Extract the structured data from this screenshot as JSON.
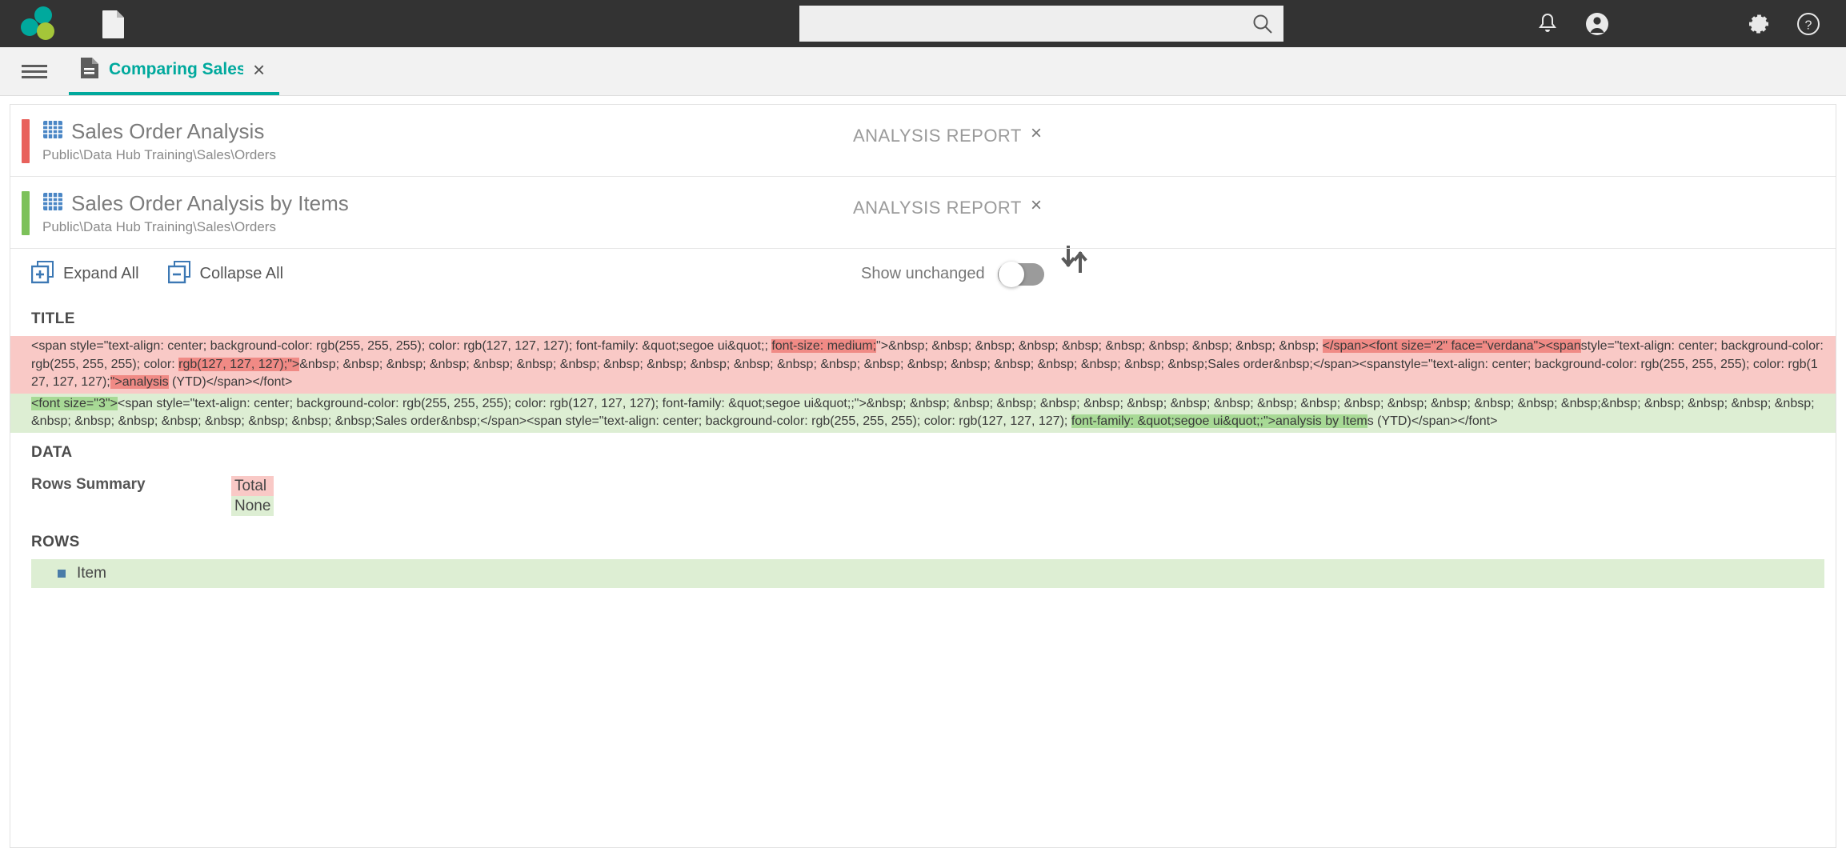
{
  "topbar": {
    "logo_name": "app-logo",
    "doc_icon": "document-icon",
    "search": {
      "value": "",
      "placeholder": ""
    },
    "icons": {
      "notifications": "bell-icon",
      "account": "user-account-icon",
      "settings": "gear-icon",
      "help": "help-icon"
    }
  },
  "tab": {
    "label": "Comparing Sales Orde",
    "close": "×",
    "icon": "document-compare-icon"
  },
  "reports": [
    {
      "title": "Sales Order Analysis",
      "path": "Public\\Data Hub Training\\Sales\\Orders",
      "kind": "ANALYSIS REPORT",
      "close": "×",
      "accent_color": "#e8615c",
      "icon": "grid-table-icon"
    },
    {
      "title": "Sales Order Analysis by Items",
      "path": "Public\\Data Hub Training\\Sales\\Orders",
      "kind": "ANALYSIS REPORT",
      "close": "×",
      "accent_color": "#7cc15a",
      "icon": "grid-table-icon"
    }
  ],
  "swap_button": {
    "name": "swap-reports-button"
  },
  "toolbar": {
    "expand_all": "Expand All",
    "collapse_all": "Collapse All",
    "show_unchanged_label": "Show unchanged",
    "show_unchanged_on": false
  },
  "sections": {
    "title": {
      "heading": "TITLE",
      "removed": [
        {
          "pre": "<span style=\"text-align: center; background-color: rgb(255, 255, 255); color: rgb(127, 127, 127); font-family: &quot;segoe ui&quot;; ",
          "hl": "font-size: medium;",
          "post": "\">&nbsp; &nbsp; &nbsp; &nbsp; &nbsp; &nbsp; &nbsp; &nbsp; &nbsp; &nbsp; ",
          "hl2": "</span><font size=\"2\" face=\"verdana\"><span"
        },
        {
          "pre": "style=\"text-align: center; background-color: rgb(255, 255, 255); color: ",
          "hl": "rgb(127, 127, 127);\">",
          "post": "&nbsp; &nbsp; &nbsp; &nbsp; &nbsp; &nbsp; &nbsp; &nbsp; &nbsp; &nbsp; &nbsp; &nbsp; &nbsp; &nbsp; &nbsp; &nbsp; &nbsp; &nbsp; &nbsp; &nbsp; &nbsp;Sales order&nbsp;</span><span"
        },
        {
          "pre": "style=\"text-align: center; background-color: rgb(255, 255, 255); color: rgb(127, 127, 127);",
          "hl": "\">analysis",
          "post": " (YTD)</span></font>"
        }
      ],
      "added": [
        {
          "hl": "<font size=\"3\">",
          "post": "<span style=\"text-align: center; background-color: rgb(255, 255, 255); color: rgb(127, 127, 127); font-family: &quot;segoe ui&quot;;\">&nbsp; &nbsp; &nbsp; &nbsp; &nbsp; &nbsp; &nbsp; &nbsp; &nbsp; &nbsp; &nbsp; &nbsp; &nbsp; &nbsp; &nbsp; &nbsp; &nbsp;"
        },
        {
          "pre": "&nbsp; &nbsp; &nbsp; &nbsp; &nbsp; &nbsp; &nbsp; &nbsp; &nbsp; &nbsp; &nbsp; &nbsp; &nbsp;Sales order&nbsp;</span><span style=\"text-align: center; background-color: rgb(255, 255, 255); color: rgb(127, 127, 127); ",
          "hl": "font-family: &quot;segoe ui&quot;;\">analysis by Item",
          "post": "s (YTD)"
        },
        {
          "pre": "</span></font>"
        }
      ]
    },
    "data": {
      "heading": "DATA",
      "rows": [
        {
          "label": "Rows Summary",
          "removed": "Total",
          "added": "None"
        }
      ]
    },
    "rows": {
      "heading": "ROWS",
      "items": [
        {
          "label": "Item",
          "state": "added"
        }
      ]
    }
  }
}
